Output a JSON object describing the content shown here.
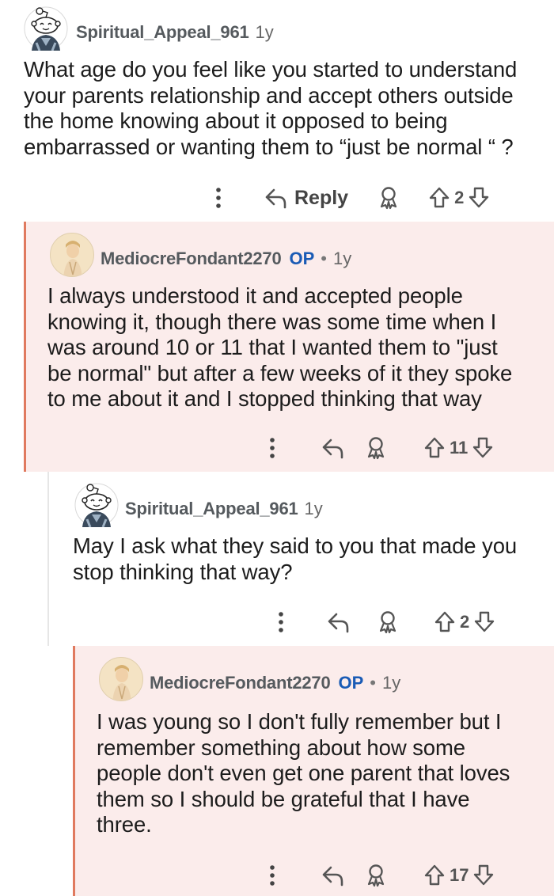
{
  "comments": [
    {
      "username": "Spiritual_Appeal_961",
      "age": "1y",
      "lines": [
        "What age do you feel like you started to understand",
        "your parents relationship and accept others outside",
        "the home knowing about it opposed to being",
        "embarrassed or wanting them to “just be normal “ ?"
      ],
      "reply_label": "Reply",
      "votes": "2"
    },
    {
      "username": "MediocreFondant2270",
      "op_badge": "OP",
      "separator": "•",
      "age": "1y",
      "lines": [
        "I always understood it and accepted people",
        "knowing it, though there was some time when I",
        "was around 10 or 11 that I wanted them to \"just",
        "be normal\" but after a few weeks of it they spoke",
        "to me about it and I stopped thinking that way"
      ],
      "votes": "11"
    },
    {
      "username": "Spiritual_Appeal_961",
      "age": "1y",
      "lines": [
        "May I ask what they said to you that made you",
        "stop thinking that way?"
      ],
      "votes": "2"
    },
    {
      "username": "MediocreFondant2270",
      "op_badge": "OP",
      "separator": "•",
      "age": "1y",
      "lines": [
        "I was young so I don't fully remember but I",
        "remember something about how some",
        "people don't even get one parent that loves",
        "them so I should be grateful that I have",
        "three."
      ],
      "votes": "17"
    }
  ],
  "icons": {
    "more": "more-options-icon",
    "reply": "reply-arrow-icon",
    "award": "award-icon",
    "upvote": "upvote-icon",
    "downvote": "downvote-icon"
  },
  "colors": {
    "op_highlight_bg": "#fbeceb",
    "op_thread_line": "#e07a5f",
    "op_badge": "#1a5bb5",
    "username": "#555a5e"
  }
}
